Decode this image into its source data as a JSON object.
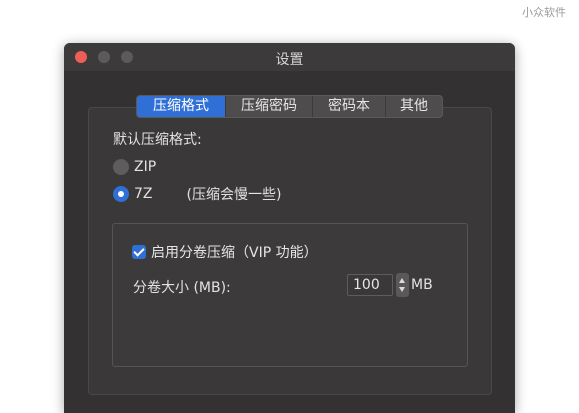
{
  "watermark": "小众软件",
  "window": {
    "title": "设置"
  },
  "tabs": [
    {
      "label": "压缩格式",
      "active": true
    },
    {
      "label": "压缩密码",
      "active": false
    },
    {
      "label": "密码本",
      "active": false
    },
    {
      "label": "其他",
      "active": false
    }
  ],
  "format": {
    "label": "默认压缩格式:",
    "options": [
      {
        "label": "ZIP",
        "selected": false
      },
      {
        "label": "7Z",
        "selected": true,
        "note": "(压缩会慢一些)"
      }
    ]
  },
  "split": {
    "enable_label": "启用分卷压缩（VIP 功能）",
    "enabled": true,
    "size_label": "分卷大小 (MB):",
    "size_value": "100",
    "unit": "MB"
  },
  "colors": {
    "accent": "#2f6fd6",
    "window_bg": "#333131",
    "close_light": "#ee5e57"
  }
}
